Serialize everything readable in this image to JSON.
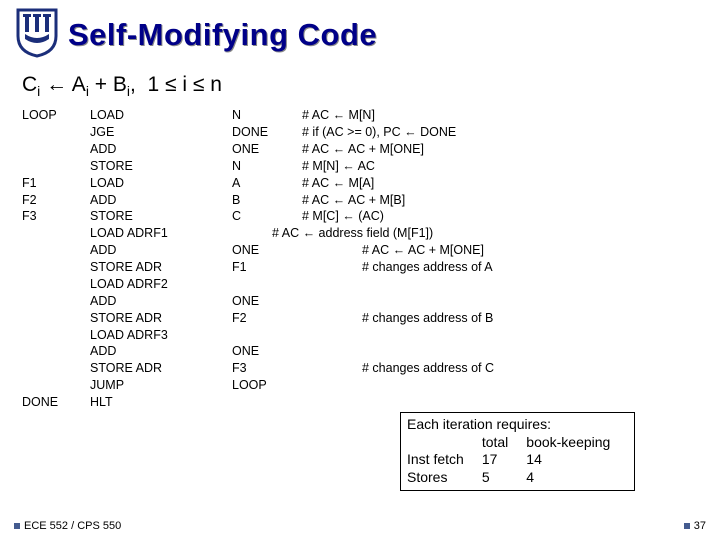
{
  "title": "Self-Modifying Code",
  "formula_html": "C<sub>i</sub> ← A<sub>i</sub> + B<sub>i</sub>,  1 ≤ i ≤ n",
  "rows": [
    {
      "lbl": "LOOP",
      "op": "LOAD",
      "opd": "N",
      "cmt": "# AC ← M[N]"
    },
    {
      "lbl": "",
      "op": "JGE",
      "opd": "DONE",
      "cmt": "# if (AC >= 0), PC ← DONE"
    },
    {
      "lbl": "",
      "op": "ADD",
      "opd": "ONE",
      "cmt": "# AC ← AC + M[ONE]"
    },
    {
      "lbl": "",
      "op": "STORE",
      "opd": "N",
      "cmt": "# M[N] ← AC"
    },
    {
      "lbl": "F1",
      "op": "LOAD",
      "opd": "A",
      "cmt": "# AC ← M[A]"
    },
    {
      "lbl": "F2",
      "op": "ADD",
      "opd": "B",
      "cmt": "# AC ← AC + M[B]"
    },
    {
      "lbl": "F3",
      "op": "STORE",
      "opd": "C",
      "cmt": "# M[C] ← (AC)"
    },
    {
      "lbl": "",
      "op": "LOAD ADRF1",
      "opd": "",
      "cmt_before": "# AC ← address field (M[F1])",
      "cmt": ""
    },
    {
      "lbl": "",
      "op": "ADD",
      "opd": "ONE",
      "cmt": "# AC ← AC + M[ONE]",
      "indent": true
    },
    {
      "lbl": "",
      "op": "STORE ADR",
      "opd": "F1",
      "cmt": "# changes address of A",
      "indent": true
    },
    {
      "lbl": "",
      "op": "LOAD ADRF2",
      "opd": "",
      "cmt": ""
    },
    {
      "lbl": "",
      "op": "ADD",
      "opd": "ONE",
      "cmt": ""
    },
    {
      "lbl": "",
      "op": "STORE ADR",
      "opd": "F2",
      "cmt": "# changes address of B",
      "indent": true
    },
    {
      "lbl": "",
      "op": "LOAD ADRF3",
      "opd": "",
      "cmt": ""
    },
    {
      "lbl": "",
      "op": "ADD",
      "opd": "ONE",
      "cmt": ""
    },
    {
      "lbl": "",
      "op": "STORE ADR",
      "opd": "F3",
      "cmt": "# changes address of C",
      "indent": true
    },
    {
      "lbl": "",
      "op": "JUMP",
      "opd": "LOOP",
      "cmt": ""
    },
    {
      "lbl": "DONE",
      "op": "HLT",
      "opd": "",
      "cmt": ""
    }
  ],
  "eachbox": {
    "lead": "Each iteration requires:",
    "hdr": [
      "",
      "total",
      "book-keeping"
    ],
    "r1": [
      "Inst fetch",
      "17",
      "14"
    ],
    "r2": [
      "Stores",
      "5",
      "4"
    ]
  },
  "footer_left": "ECE 552 / CPS 550",
  "footer_right": "37"
}
